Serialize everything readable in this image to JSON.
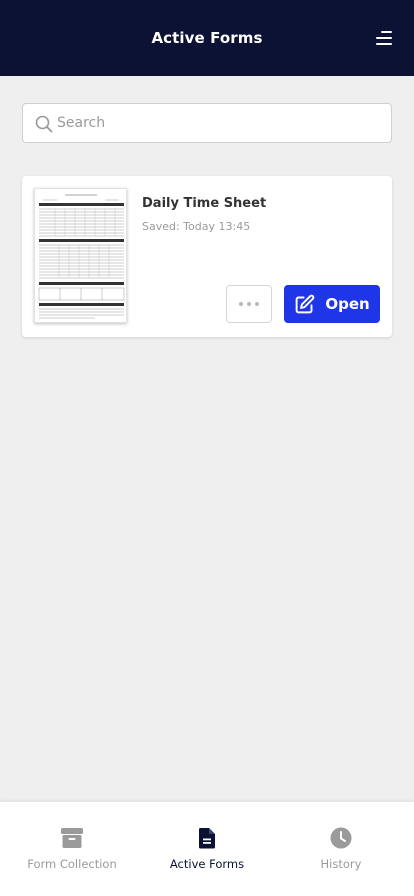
{
  "header": {
    "title": "Active Forms",
    "menu_icon": "hamburger-menu-icon"
  },
  "search": {
    "placeholder": "Search",
    "value": "",
    "icon": "search-icon"
  },
  "forms": [
    {
      "title": "Daily Time Sheet",
      "saved": "Saved: Today 13:45",
      "thumbnail_icon": "form-preview",
      "more_icon": "more-dots-icon",
      "open_label": "Open",
      "open_icon": "edit-icon"
    }
  ],
  "tabs": [
    {
      "label": "Form Collection",
      "icon": "archive-box-icon",
      "active": false
    },
    {
      "label": "Active Forms",
      "icon": "document-icon",
      "active": true
    },
    {
      "label": "History",
      "icon": "clock-icon",
      "active": false
    }
  ],
  "colors": {
    "header_bg": "#0b1233",
    "accent": "#1f35e8",
    "background": "#efefef",
    "tab_inactive": "#9a9a9a",
    "tab_active": "#0b1233"
  }
}
